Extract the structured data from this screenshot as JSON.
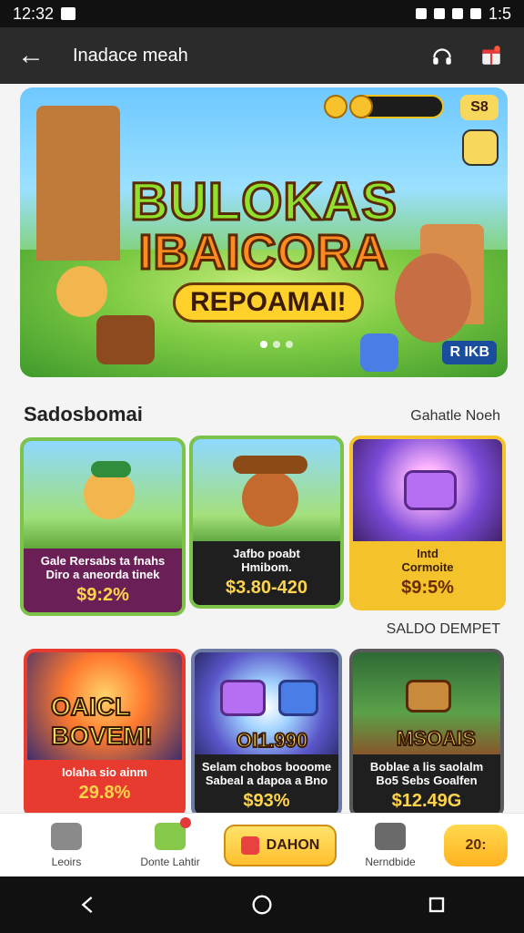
{
  "status_bar": {
    "time": "12:32",
    "battery_text": "1:5"
  },
  "app_bar": {
    "title": "Inadace meah",
    "back_label": "←",
    "icons": [
      "headphones-icon",
      "gift-icon"
    ]
  },
  "banner": {
    "headline_1": "BULOKAS",
    "headline_2": "IBAICORA",
    "pill_label": "REPOAMAI!",
    "badge_label": "R IKB",
    "right_small_label": "S8"
  },
  "sections": {
    "featured_title": "Sadosbomai",
    "featured_link": "Gahatle Noeh",
    "secondary_title": "SALDO DEMPET"
  },
  "cards_top": [
    {
      "line1": "Gale Rersabs ta fnahs",
      "line2": "Diro a aneorda tinek",
      "price": "$9:2%"
    },
    {
      "line1": "Jafbo poabt",
      "line2": "Hmibom.",
      "price": "$3.80-420"
    },
    {
      "line1": "Intd",
      "line2": "Cormoite",
      "price": "$9:5%"
    }
  ],
  "cards_bottom": [
    {
      "art_text": "OAICL BOVEM!",
      "line1": "Iolaha sio ainm",
      "price": "29.8%"
    },
    {
      "art_text": "OI1.990",
      "line1": "Selam chobos booome",
      "line2": "Sabeal a dapoa a Bno",
      "price": "$93%"
    },
    {
      "art_text": "MSOAIS",
      "line1": "Boblae a lis saolalm",
      "line2": "Bo5 Sebs Goalfen",
      "price": "$12.49G"
    }
  ],
  "bottom_nav": {
    "items": [
      "Leoirs",
      "Donte Lahtir",
      "Nerndbide"
    ],
    "cta_label": "DAHON",
    "promo_label": "20:"
  },
  "colors": {
    "card_green": "#7cc34a",
    "card_yellow": "#f4c22b",
    "card_purple": "#6b1f57",
    "dark_bar": "#2b2b2b"
  }
}
